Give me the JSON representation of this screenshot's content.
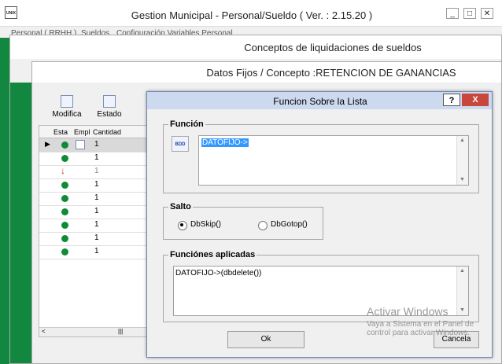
{
  "app": {
    "title": "Gestion Municipal - Personal/Sueldo ( Ver. : 2.15.20 )",
    "logo_text": "UNIX",
    "menu": [
      "Personal ( RRHH )",
      "Sueldos",
      "Configuración Variables Personal"
    ]
  },
  "window2": {
    "title": "Conceptos de liquidaciones de sueldos"
  },
  "window3": {
    "title": "Datos Fijos / Concepto :RETENCION DE GANANCIAS",
    "toolbar": {
      "modifica": "Modifica",
      "estado": "Estado"
    },
    "grid": {
      "headers": [
        "Esta",
        "Empl",
        "Cantidad"
      ],
      "rows": [
        {
          "status": "green",
          "qty": "1"
        },
        {
          "status": "green",
          "qty": "1"
        },
        {
          "status": "red",
          "qty": "1"
        },
        {
          "status": "green",
          "qty": "1"
        },
        {
          "status": "green",
          "qty": "1"
        },
        {
          "status": "green",
          "qty": "1"
        },
        {
          "status": "green",
          "qty": "1"
        },
        {
          "status": "green",
          "qty": "1"
        },
        {
          "status": "green",
          "qty": "1"
        }
      ]
    }
  },
  "dialog": {
    "title": "Funcion Sobre la Lista",
    "help_label": "?",
    "close_label": "X",
    "funcion": {
      "legend": "Función",
      "value": "DATOFIJO->",
      "icon_label": "BDD"
    },
    "salto": {
      "legend": "Salto",
      "option1": "DbSkip()",
      "option2": "DbGotop()",
      "selected": "DbSkip()"
    },
    "aplicadas": {
      "legend": "Funciónes aplicadas",
      "value": "DATOFIJO->(dbdelete())"
    },
    "ok_label": "Ok",
    "cancel_label": "Cancela"
  },
  "watermark": {
    "line1": "Activar Windows",
    "line2": "Vaya a Sistema en el Panel de",
    "line3": "control para activar Windows."
  },
  "colors": {
    "green": "#12873f",
    "dialog_title": "#ccd9ef",
    "close": "#c9463d",
    "selection": "#3399ff"
  }
}
